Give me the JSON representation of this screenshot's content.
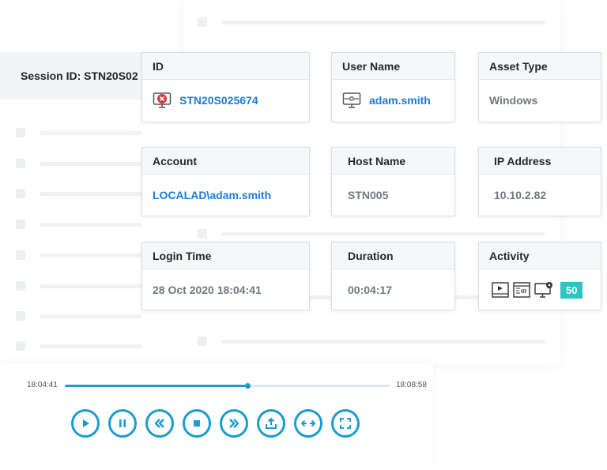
{
  "background": {
    "session_header": "Session ID: STN20S02"
  },
  "cards": {
    "id": {
      "label": "ID",
      "value": "STN20S025674",
      "icon": "monitor-alert-icon"
    },
    "user_name": {
      "label": "User Name",
      "value": "adam.smith",
      "icon": "monitor-user-icon"
    },
    "asset_type": {
      "label": "Asset Type",
      "value": "Windows"
    },
    "account": {
      "label": "Account",
      "value": "LOCALAD\\adam.smith"
    },
    "host_name": {
      "label": "Host Name",
      "value": "STN005"
    },
    "ip_address": {
      "label": "IP Address",
      "value": "10.10.2.82"
    },
    "login_time": {
      "label": "Login Time",
      "value": "28 Oct 2020 18:04:41"
    },
    "duration": {
      "label": "Duration",
      "value": "00:04:17"
    },
    "activity": {
      "label": "Activity",
      "count": "50",
      "icons": [
        "video-play-icon",
        "code-window-icon",
        "monitor-settings-icon"
      ]
    }
  },
  "player": {
    "start_time": "18:04:41",
    "end_time": "18:08:58",
    "progress": 0.56,
    "buttons": [
      "play",
      "pause",
      "rewind",
      "stop",
      "fast-forward",
      "export",
      "fit-width",
      "fullscreen"
    ]
  },
  "colors": {
    "accent": "#1a9bd1",
    "link": "#1f7ad6",
    "badge": "#2ec4c0"
  }
}
